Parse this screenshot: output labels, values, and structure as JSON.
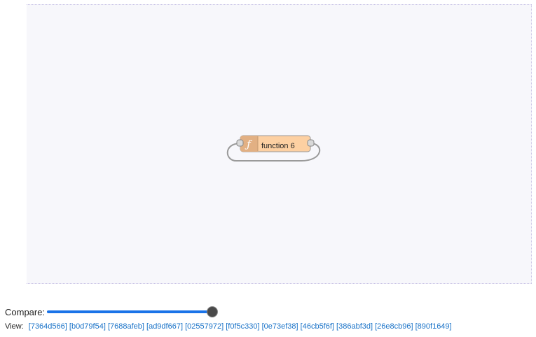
{
  "flow": {
    "node": {
      "label": "function 6",
      "icon": "function-icon",
      "icon_glyph": "ƒ",
      "fill_color": "#fdd0a2",
      "icon_area_color": "#e2b083"
    }
  },
  "compare": {
    "label": "Compare:",
    "level": 1.0,
    "fill_color": "#1a73e8"
  },
  "view": {
    "label": "View:",
    "links": [
      "[7364d566]",
      "[b0d79f54]",
      "[7688afeb]",
      "[ad9df667]",
      "[02557972]",
      "[f0f5c330]",
      "[0e73ef38]",
      "[46cb5f6f]",
      "[386abf3d]",
      "[26e8cb96]",
      "[890f1649]"
    ],
    "link_color": "#1a73c8"
  }
}
